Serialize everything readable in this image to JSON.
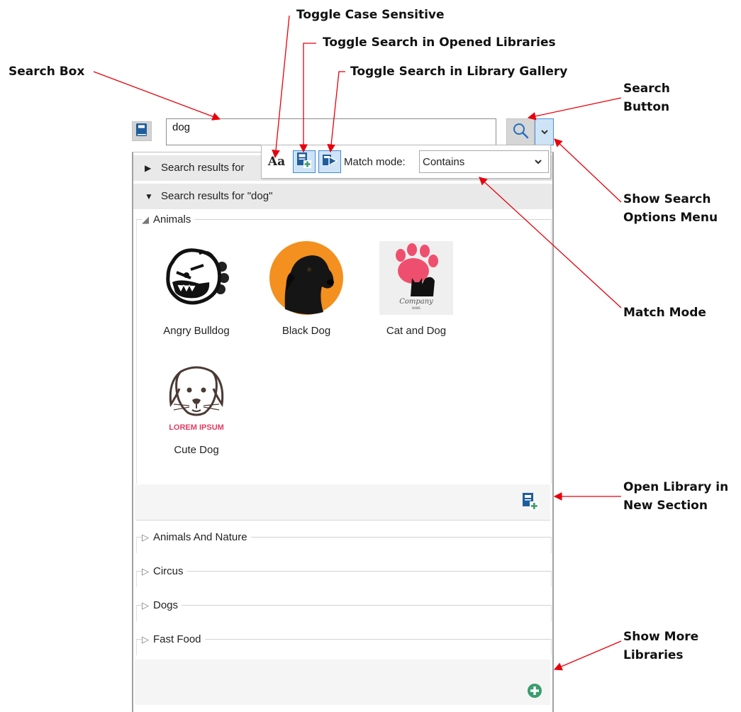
{
  "callouts": {
    "search_box": "Search Box",
    "case_sensitive": "Toggle Case Sensitive",
    "opened_libraries": "Toggle Search in Opened Libraries",
    "library_gallery": "Toggle Search in Library Gallery",
    "search_button": "Search Button",
    "options_menu": "Show Search Options Menu",
    "match_mode": "Match Mode",
    "open_library": "Open Library in New Section",
    "more_libraries": "Show More Libraries"
  },
  "search": {
    "value": "dog"
  },
  "options": {
    "case_label": "Aa",
    "match_label": "Match mode:",
    "match_value": "Contains"
  },
  "results": {
    "collapsed_header": "Search results for",
    "expanded_header": "Search results for \"dog\""
  },
  "groups": {
    "animals": {
      "title": "Animals",
      "items": [
        {
          "label": "Angry Bulldog"
        },
        {
          "label": "Black Dog"
        },
        {
          "label": "Cat and Dog"
        },
        {
          "label": "Cute Dog"
        }
      ]
    },
    "collapsed": [
      {
        "title": "Animals And Nature"
      },
      {
        "title": "Circus"
      },
      {
        "title": "Dogs"
      },
      {
        "title": "Fast Food"
      }
    ]
  },
  "thumb_text": {
    "company": "Company",
    "name": "NAME",
    "lorem": "LOREM IPSUM"
  },
  "colors": {
    "arrow": "#e8000b",
    "toggle_active": "#cfe3f7",
    "toggle_border": "#3d8ad6",
    "add_icon": "#3a9d6e",
    "library_icon": "#1f5e9c",
    "paw": "#ef4f6e",
    "black_dog_bg": "#f3901f",
    "lorem": "#e23b63"
  },
  "icons": [
    "library-icon",
    "search-icon",
    "chevron-down-icon",
    "case-sensitive-icon",
    "opened-libraries-icon",
    "library-gallery-icon",
    "triangle-right-icon",
    "triangle-down-icon",
    "expand-triangle-icon",
    "open-library-new-section-icon",
    "add-circle-icon"
  ]
}
